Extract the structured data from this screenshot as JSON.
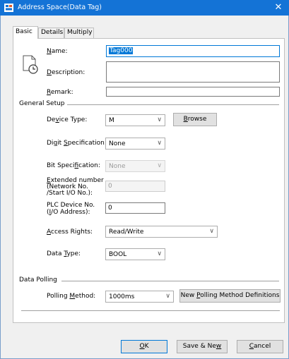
{
  "window": {
    "title": "Address Space(Data Tag)",
    "close_glyph": "✕"
  },
  "tabs": [
    {
      "label": "Basic"
    },
    {
      "label": "Details"
    },
    {
      "label": "Multiply"
    }
  ],
  "fields": {
    "name": {
      "label": "Name:",
      "value": "Tag000"
    },
    "description": {
      "label": "Description:",
      "value": ""
    },
    "remark": {
      "label": "Remark:",
      "value": ""
    }
  },
  "general_setup": {
    "title": "General Setup",
    "device_type": {
      "label": "Device Type:",
      "value": "M",
      "browse_label": "Browse"
    },
    "digit_spec": {
      "label": "Digit Specification:",
      "value": "None"
    },
    "bit_spec": {
      "label": "Bit Specification:",
      "value": "None"
    },
    "extended_number": {
      "label_line1": "Extended number",
      "label_line2": "(Network No.",
      "label_line3": "/Start I/O No.):",
      "value": "0"
    },
    "plc_device_no": {
      "label_line1": "PLC Device No.",
      "label_line2": "(I/O Address):",
      "value": "0"
    },
    "access_rights": {
      "label": "Access Rights:",
      "value": "Read/Write"
    },
    "data_type": {
      "label": "Data Type:",
      "value": "BOOL"
    }
  },
  "data_polling": {
    "title": "Data Polling",
    "polling_method": {
      "label": "Polling Method:",
      "value": "1000ms"
    },
    "new_polling_button": "New Polling Method Definitions"
  },
  "footer": {
    "ok": "OK",
    "save_new": "Save & New",
    "cancel": "Cancel"
  }
}
